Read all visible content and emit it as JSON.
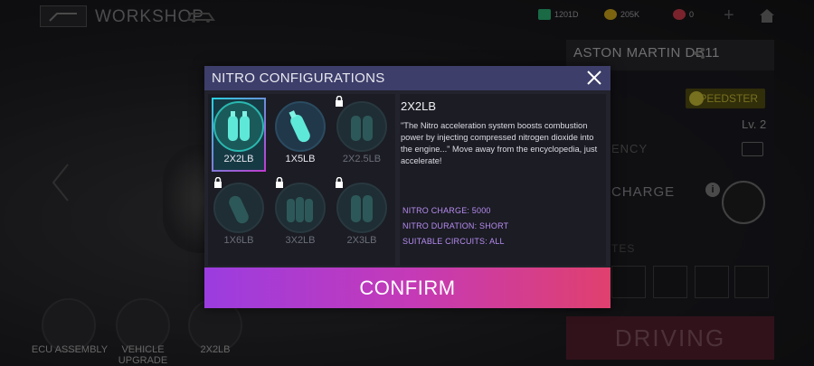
{
  "header": {
    "title": "WORKSHOP",
    "resources": [
      {
        "icon": "cash-icon",
        "value": "1201D",
        "color": "#2ec27e"
      },
      {
        "icon": "star-coin-icon",
        "value": "205K",
        "color": "#e2b51d"
      },
      {
        "icon": "gem-icon",
        "value": "0",
        "color": "#e04050"
      }
    ]
  },
  "car": {
    "name": "ASTON MARTIN DB11",
    "class_badge": "SPEEDSTER",
    "level": "Lv. 2",
    "encyclopedia_label": "ENCY",
    "charge_label": "CHARGE",
    "upgrades_label": "TES"
  },
  "bottom": {
    "items": [
      {
        "label": "ECU ASSEMBLY"
      },
      {
        "label": "VEHICLE UPGRADE"
      },
      {
        "label": "2X2LB"
      }
    ],
    "driving_label": "DRIVING"
  },
  "modal": {
    "title": "NITRO CONFIGURATIONS",
    "options": [
      {
        "label": "2X2LB",
        "locked": false,
        "selected": true
      },
      {
        "label": "1X5LB",
        "locked": false,
        "selected": false
      },
      {
        "label": "2X2.5LB",
        "locked": true,
        "selected": false
      },
      {
        "label": "1X6LB",
        "locked": true,
        "selected": false
      },
      {
        "label": "3X2LB",
        "locked": true,
        "selected": false
      },
      {
        "label": "2X3LB",
        "locked": true,
        "selected": false
      }
    ],
    "detail": {
      "name": "2X2LB",
      "description": "\"The Nitro acceleration system boosts combustion power by injecting compressed nitrogen dioxide into the engine...\" Move away from the encyclopedia, just accelerate!",
      "nitro_charge": "NITRO CHARGE: 5000",
      "nitro_duration": "NITRO DURATION: SHORT",
      "suitable_circuits": "SUITABLE CIRCUITS: ALL"
    },
    "confirm_label": "CONFIRM"
  }
}
